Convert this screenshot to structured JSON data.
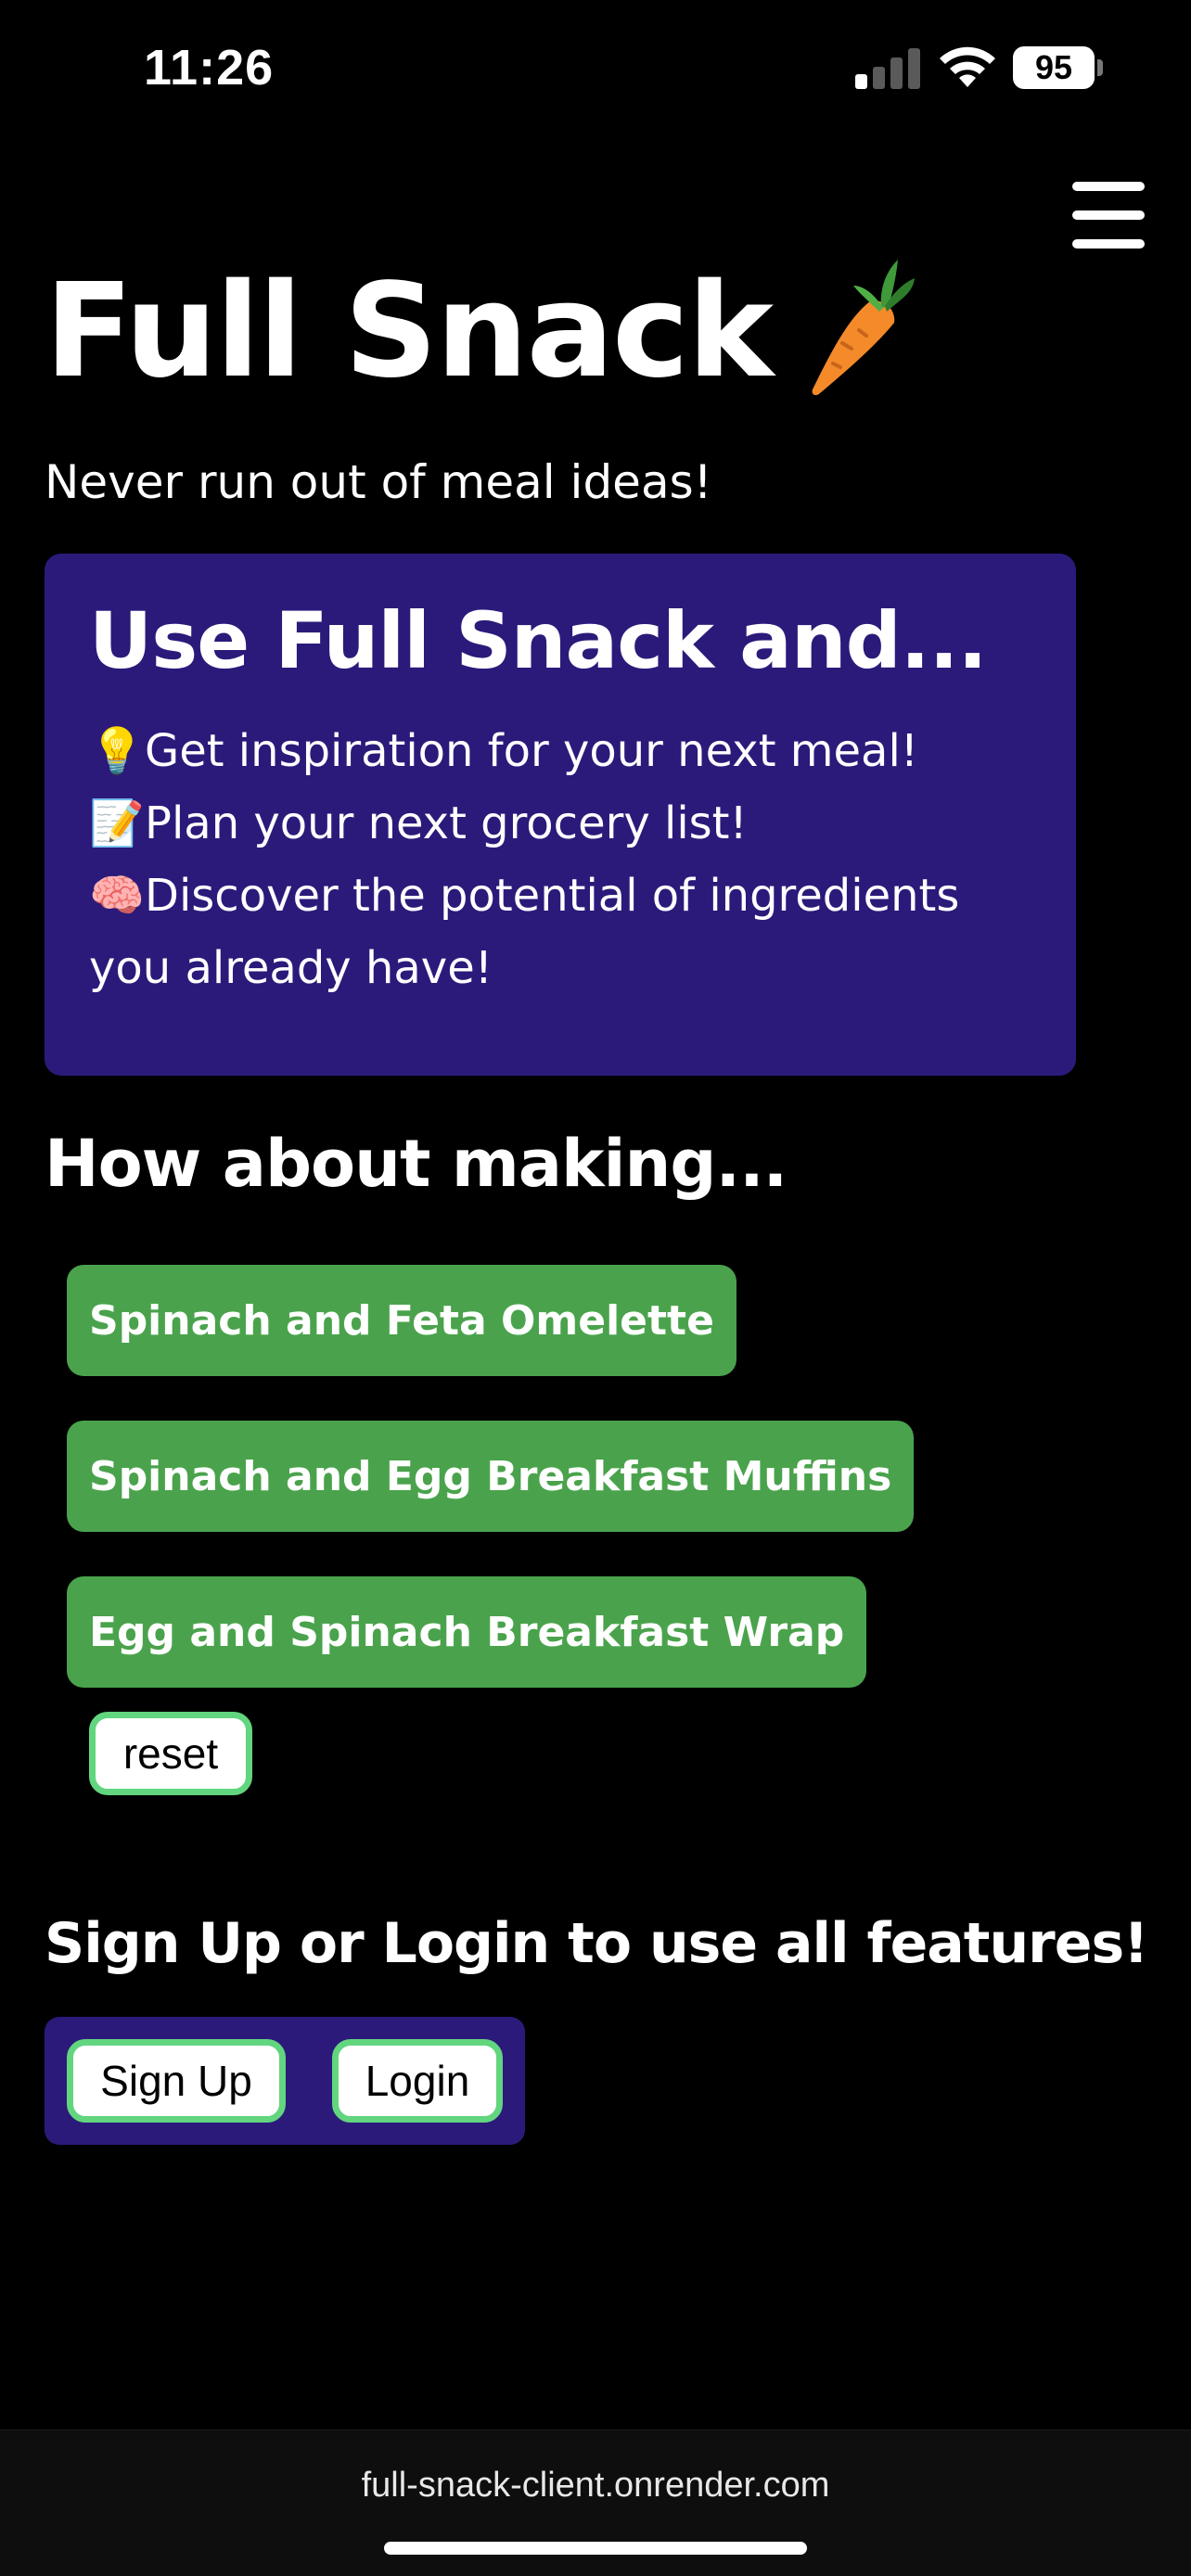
{
  "status_bar": {
    "time": "11:26",
    "battery": "95",
    "icons": [
      "cellular-signal-icon",
      "wifi-icon",
      "battery-icon"
    ]
  },
  "header": {
    "menu_icon": "hamburger-menu-icon",
    "title": "Full Snack",
    "title_icon": "carrot-icon",
    "tagline": "Never run out of meal ideas!"
  },
  "features": {
    "heading": "Use Full Snack and...",
    "items": [
      {
        "emoji": "💡",
        "text": "Get inspiration for your next meal!"
      },
      {
        "emoji": "📝",
        "text": "Plan your next grocery list!"
      },
      {
        "emoji": "🧠",
        "text": "Discover the potential of ingredients you already have!"
      }
    ]
  },
  "suggestions": {
    "heading": "How about making...",
    "meals": [
      "Spinach and Feta Omelette",
      "Spinach and Egg Breakfast Muffins",
      "Egg and Spinach Breakfast Wrap"
    ],
    "reset_label": "reset"
  },
  "auth": {
    "heading": "Sign Up or Login to use all features!",
    "signup_label": "Sign Up",
    "login_label": "Login"
  },
  "browser": {
    "url": "full-snack-client.onrender.com"
  },
  "colors": {
    "background": "#000000",
    "card_purple": "#2b1a7a",
    "meal_green": "#4aa34c",
    "button_border_green": "#62d57f"
  }
}
